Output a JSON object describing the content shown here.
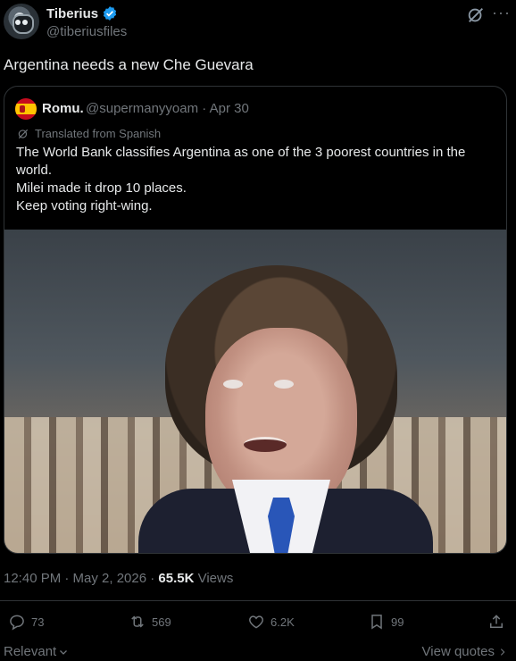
{
  "author": {
    "name": "Tiberius",
    "handle": "@tiberiusfiles",
    "verified": true
  },
  "tweet": {
    "text": "Argentina needs a new Che Guevara"
  },
  "quote": {
    "name": "Romu.",
    "handle_date": "@supermanyyoam · Apr 30",
    "translated_label": "Translated from Spanish",
    "lines": [
      "The World Bank classifies Argentina as one of the 3 poorest countries in the",
      "world.",
      "Milei made it drop 10 places.",
      "Keep voting right-wing."
    ]
  },
  "meta": {
    "timestamp": "12:40 PM · May 2, 2026 · ",
    "views_count": "65.5K",
    "views_label": " Views"
  },
  "actions": {
    "replies": "73",
    "reposts": "569",
    "likes": "6.2K",
    "bookmarks": "99"
  },
  "footer": {
    "relevant": "Relevant",
    "view_quotes": "View quotes"
  },
  "icons": {
    "verified": "verified-badge-icon",
    "grok": "grok-icon",
    "more": "more-icon",
    "reply": "reply-icon",
    "repost": "repost-icon",
    "like": "heart-icon",
    "bookmark": "bookmark-icon",
    "share": "share-icon"
  },
  "colors": {
    "background": "#000000",
    "text": "#e7e9ea",
    "muted": "#71767b",
    "border": "#2f3336",
    "verified": "#1d9bf0"
  }
}
